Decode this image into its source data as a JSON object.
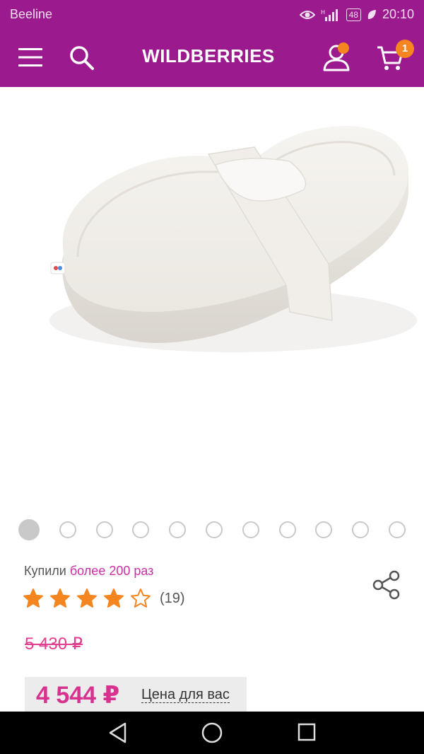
{
  "status_bar": {
    "carrier": "Beeline",
    "battery": "48",
    "time": "20:10"
  },
  "header": {
    "logo": "WILDBERRIES",
    "cart_count": "1",
    "icons": [
      "menu-icon",
      "search-icon",
      "profile-icon",
      "cart-icon"
    ],
    "brand_color": "#9b1a8e",
    "badge_color": "#f5861f"
  },
  "gallery": {
    "total": 11,
    "active_index": 0
  },
  "product": {
    "bought_prefix": "Купили",
    "bought_count": "более 200 раз",
    "rating": 4,
    "rating_max": 5,
    "reviews": "(19)",
    "old_price": "5 430 ₽",
    "price": "4 544 ₽",
    "price_note": "Цена для вас"
  },
  "colors": {
    "accent_pink": "#d8328f",
    "star": "#f5861f"
  },
  "navbar": {
    "icons": [
      "back-icon",
      "home-icon",
      "recents-icon"
    ]
  }
}
